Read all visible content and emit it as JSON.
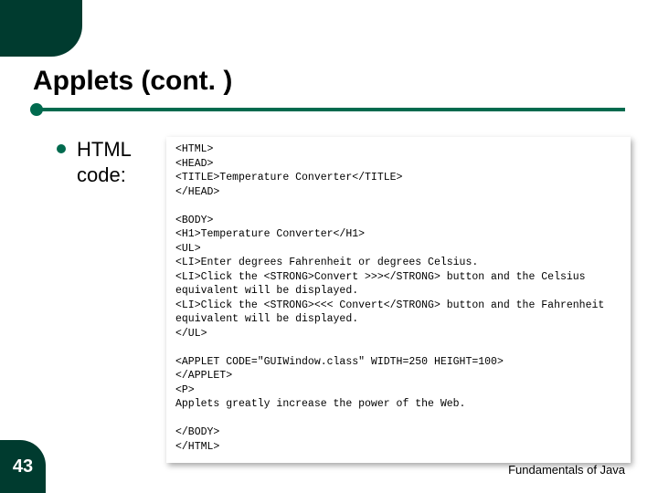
{
  "title": "Applets (cont. )",
  "bullet_label": "HTML code:",
  "code_lines": [
    "<HTML>",
    "<HEAD>",
    "<TITLE>Temperature Converter</TITLE>",
    "</HEAD>",
    "",
    "<BODY>",
    "<H1>Temperature Converter</H1>",
    "<UL>",
    "<LI>Enter degrees Fahrenheit or degrees Celsius.",
    "<LI>Click the <STRONG>Convert >>></STRONG> button and the Celsius equivalent will be displayed.",
    "<LI>Click the <STRONG><<< Convert</STRONG> button and the Fahrenheit equivalent will be displayed.",
    "</UL>",
    "",
    "<APPLET CODE=\"GUIWindow.class\" WIDTH=250 HEIGHT=100>",
    "</APPLET>",
    "<P>",
    "Applets greatly increase the power of the Web.",
    "",
    "</BODY>",
    "</HTML>"
  ],
  "page_number": "43",
  "footer": "Fundamentals of Java",
  "colors": {
    "accent_dark": "#003b2f",
    "accent": "#006a4e"
  }
}
